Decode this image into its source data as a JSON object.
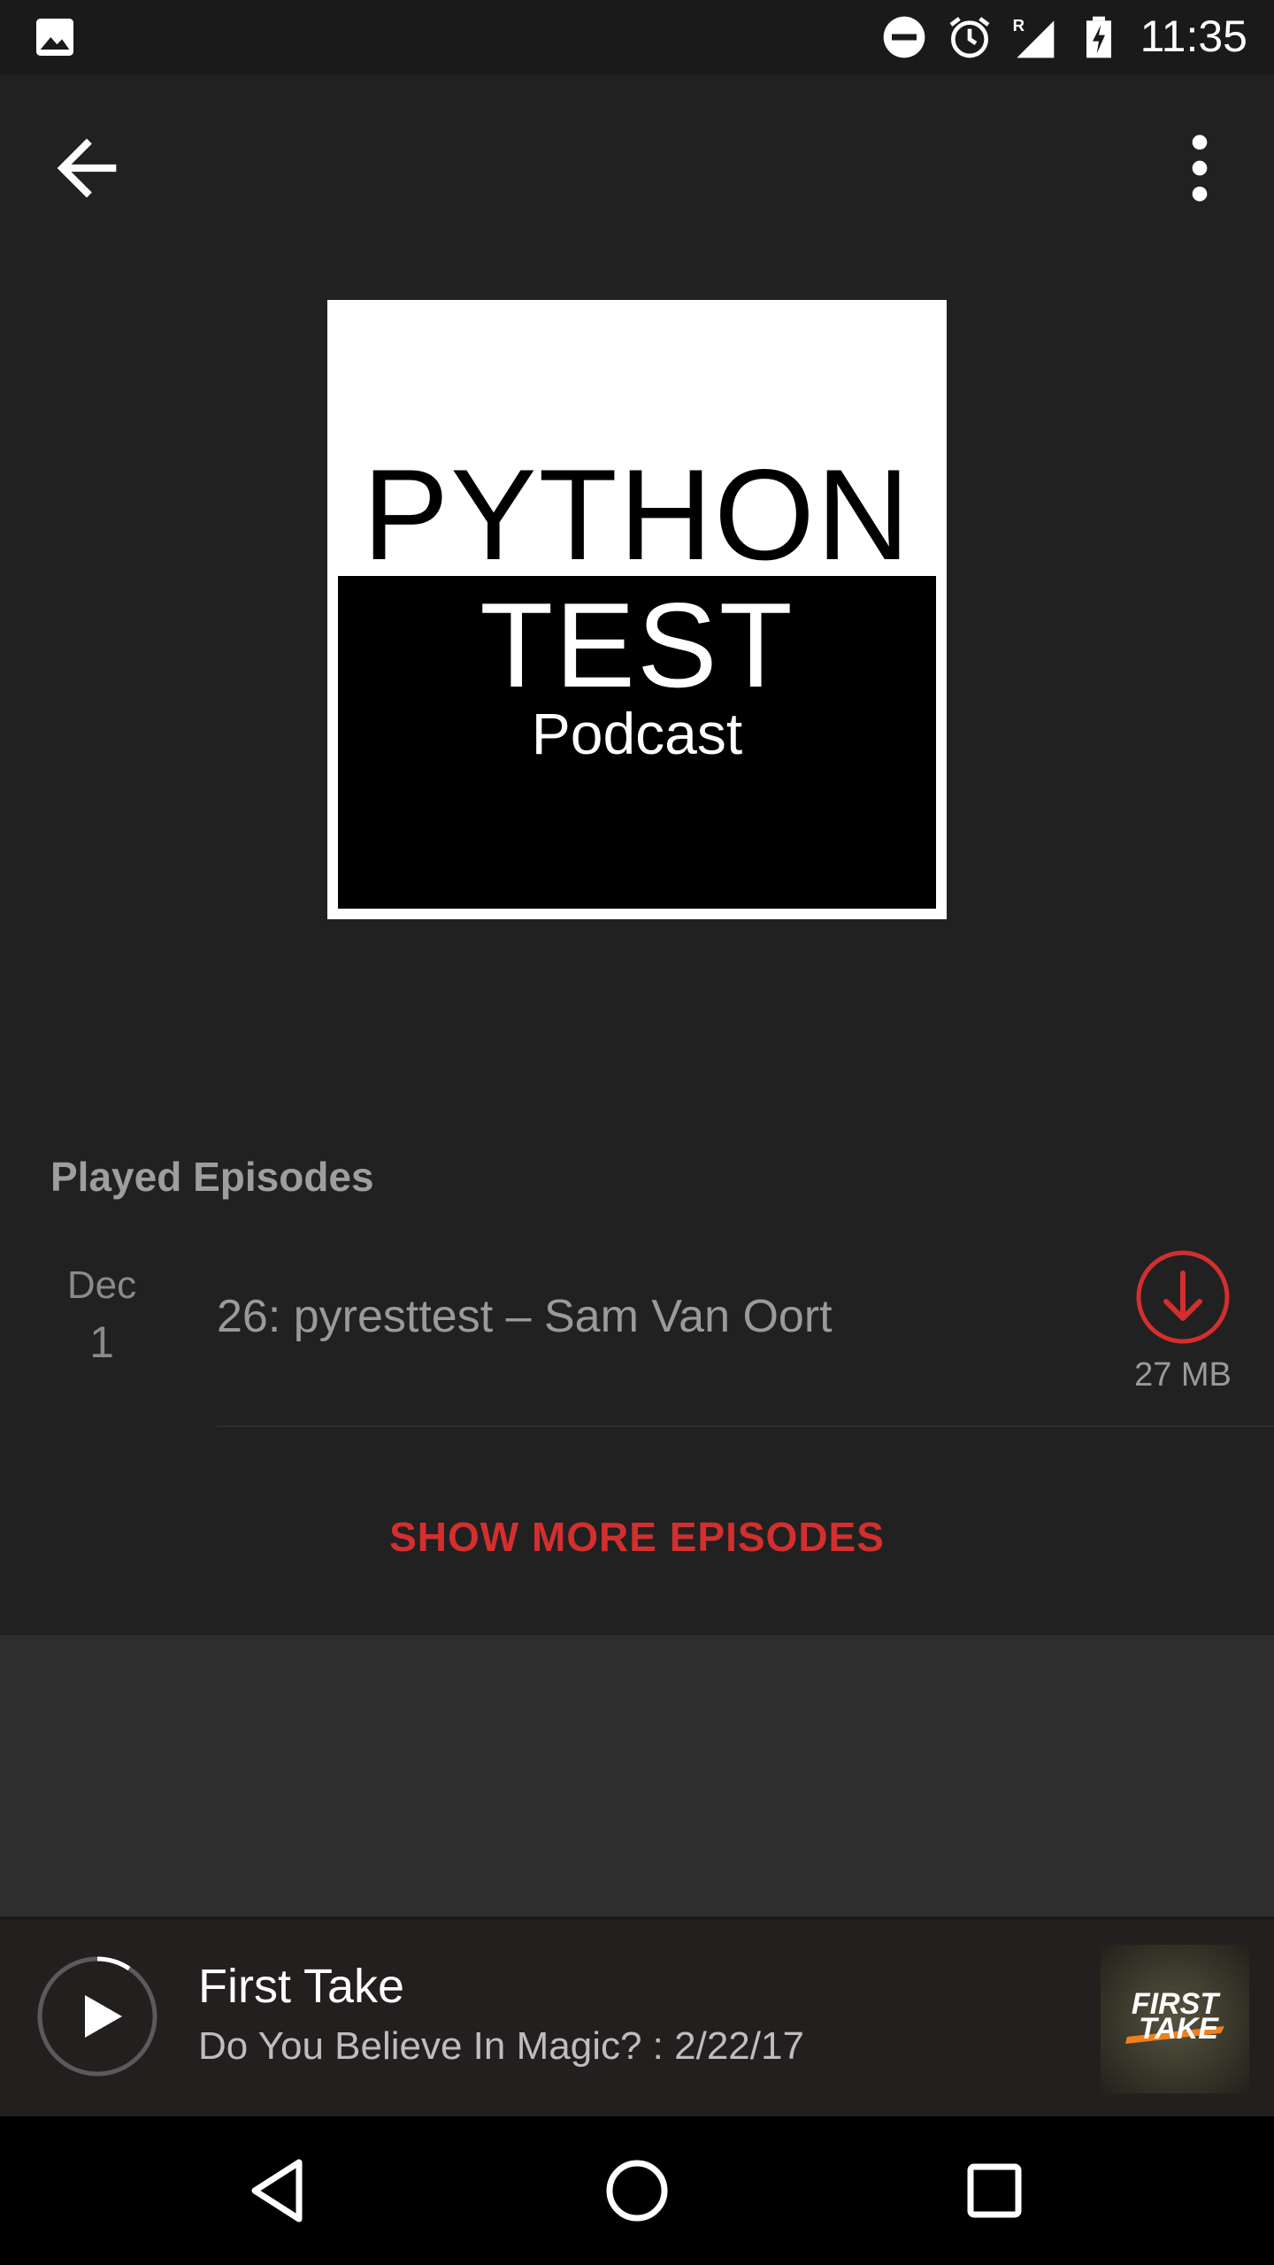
{
  "status_bar": {
    "time": "11:35",
    "icons": [
      "image-icon",
      "do-not-disturb-icon",
      "alarm-icon",
      "signal-roaming-icon",
      "battery-charging-icon"
    ]
  },
  "app_bar": {
    "back_icon": "arrow-back-icon",
    "more_icon": "more-vert-icon"
  },
  "podcast": {
    "cover": {
      "line1": "PYTHON",
      "line2": "TEST",
      "line3": "Podcast"
    }
  },
  "episodes": {
    "section_title": "Played Episodes",
    "items": [
      {
        "month": "Dec",
        "day": "1",
        "title": "26: pyresttest – Sam Van Oort",
        "size": "27 MB",
        "action_icon": "download-icon"
      }
    ],
    "show_more_label": "SHOW MORE EPISODES",
    "accent_color": "#d32f2f"
  },
  "mini_player": {
    "title": "First Take",
    "subtitle": "Do You Believe In Magic? : 2/22/17",
    "art_text_line1": "FIRST",
    "art_text_line2": "TAKE"
  },
  "nav_bar": {
    "icons": [
      "back-triangle-icon",
      "home-circle-icon",
      "recents-square-icon"
    ]
  }
}
